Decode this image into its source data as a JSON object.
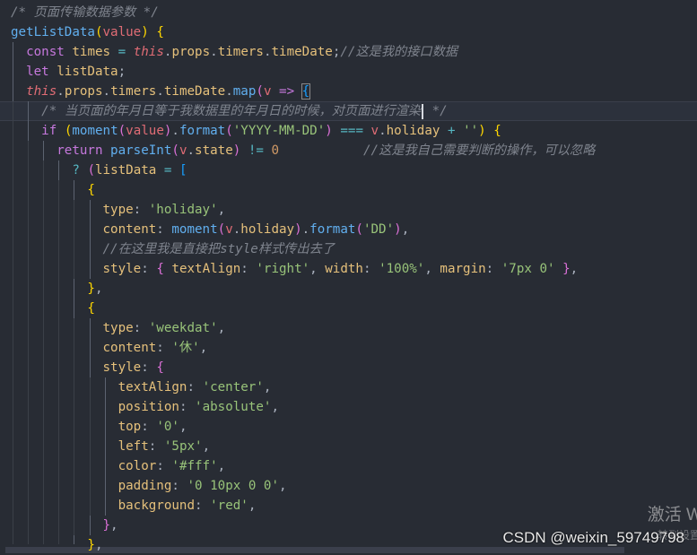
{
  "editor": {
    "lines": [
      [
        [
          "c-com",
          "/* 页面传输数据参数 */"
        ]
      ],
      [
        [
          "c-fn",
          "getListData"
        ],
        [
          "c-br1",
          "("
        ],
        [
          "c-id",
          "value"
        ],
        [
          "c-br1",
          ")"
        ],
        [
          "c-pun",
          " "
        ],
        [
          "c-br1",
          "{"
        ]
      ],
      [
        [
          "c-kw",
          "const"
        ],
        [
          "c-pun",
          " "
        ],
        [
          "c-var",
          "times"
        ],
        [
          "c-pun",
          " "
        ],
        [
          "c-op",
          "="
        ],
        [
          "c-pun",
          " "
        ],
        [
          "c-this",
          "this"
        ],
        [
          "c-pun",
          "."
        ],
        [
          "c-prop",
          "props"
        ],
        [
          "c-pun",
          "."
        ],
        [
          "c-prop",
          "timers"
        ],
        [
          "c-pun",
          "."
        ],
        [
          "c-prop",
          "timeDate"
        ],
        [
          "c-pun",
          ";"
        ],
        [
          "c-com",
          "//这是我的接口数据"
        ]
      ],
      [
        [
          "c-kw",
          "let"
        ],
        [
          "c-pun",
          " "
        ],
        [
          "c-var",
          "listData"
        ],
        [
          "c-pun",
          ";"
        ]
      ],
      [
        [
          "c-this",
          "this"
        ],
        [
          "c-pun",
          "."
        ],
        [
          "c-prop",
          "props"
        ],
        [
          "c-pun",
          "."
        ],
        [
          "c-prop",
          "timers"
        ],
        [
          "c-pun",
          "."
        ],
        [
          "c-prop",
          "timeDate"
        ],
        [
          "c-pun",
          "."
        ],
        [
          "c-fn",
          "map"
        ],
        [
          "c-br2",
          "("
        ],
        [
          "c-id",
          "v"
        ],
        [
          "c-pun",
          " "
        ],
        [
          "c-kw",
          "=>"
        ],
        [
          "c-pun",
          " "
        ],
        [
          "c-br3",
          "{"
        ]
      ],
      [
        [
          "c-com",
          "/* 当页面的年月日等于我数据里的年月日的时候，对页面进行渲染"
        ],
        [
          "cursor",
          ""
        ],
        [
          "c-com",
          " */"
        ]
      ],
      [
        [
          "c-kw",
          "if"
        ],
        [
          "c-pun",
          " "
        ],
        [
          "c-br1",
          "("
        ],
        [
          "c-fn",
          "moment"
        ],
        [
          "c-br2",
          "("
        ],
        [
          "c-id",
          "value"
        ],
        [
          "c-br2",
          ")"
        ],
        [
          "c-pun",
          "."
        ],
        [
          "c-fn",
          "format"
        ],
        [
          "c-br2",
          "("
        ],
        [
          "c-str",
          "'YYYY-MM-DD'"
        ],
        [
          "c-br2",
          ")"
        ],
        [
          "c-pun",
          " "
        ],
        [
          "c-op",
          "==="
        ],
        [
          "c-pun",
          " "
        ],
        [
          "c-id",
          "v"
        ],
        [
          "c-pun",
          "."
        ],
        [
          "c-prop",
          "holiday"
        ],
        [
          "c-pun",
          " "
        ],
        [
          "c-op",
          "+"
        ],
        [
          "c-pun",
          " "
        ],
        [
          "c-str",
          "''"
        ],
        [
          "c-br1",
          ")"
        ],
        [
          "c-pun",
          " "
        ],
        [
          "c-br1",
          "{"
        ]
      ],
      [
        [
          "c-kw",
          "return"
        ],
        [
          "c-pun",
          " "
        ],
        [
          "c-fn",
          "parseInt"
        ],
        [
          "c-br2",
          "("
        ],
        [
          "c-id",
          "v"
        ],
        [
          "c-pun",
          "."
        ],
        [
          "c-prop",
          "state"
        ],
        [
          "c-br2",
          ")"
        ],
        [
          "c-pun",
          " "
        ],
        [
          "c-op",
          "!="
        ],
        [
          "c-pun",
          " "
        ],
        [
          "c-num",
          "0"
        ],
        [
          "c-pun",
          "           "
        ],
        [
          "c-com",
          "//这是我自己需要判断的操作，可以忽略"
        ]
      ],
      [
        [
          "c-op",
          "?"
        ],
        [
          "c-pun",
          " "
        ],
        [
          "c-br2",
          "("
        ],
        [
          "c-var",
          "listData"
        ],
        [
          "c-pun",
          " "
        ],
        [
          "c-op",
          "="
        ],
        [
          "c-pun",
          " "
        ],
        [
          "c-br3",
          "["
        ]
      ],
      [
        [
          "c-br1",
          "{"
        ]
      ],
      [
        [
          "c-key",
          "type"
        ],
        [
          "c-pun",
          ": "
        ],
        [
          "c-str",
          "'holiday'"
        ],
        [
          "c-pun",
          ","
        ]
      ],
      [
        [
          "c-key",
          "content"
        ],
        [
          "c-pun",
          ": "
        ],
        [
          "c-fn",
          "moment"
        ],
        [
          "c-br2",
          "("
        ],
        [
          "c-id",
          "v"
        ],
        [
          "c-pun",
          "."
        ],
        [
          "c-prop",
          "holiday"
        ],
        [
          "c-br2",
          ")"
        ],
        [
          "c-pun",
          "."
        ],
        [
          "c-fn",
          "format"
        ],
        [
          "c-br2",
          "("
        ],
        [
          "c-str",
          "'DD'"
        ],
        [
          "c-br2",
          ")"
        ],
        [
          "c-pun",
          ","
        ]
      ],
      [
        [
          "c-com",
          "//在这里我是直接把style样式传出去了"
        ]
      ],
      [
        [
          "c-key",
          "style"
        ],
        [
          "c-pun",
          ": "
        ],
        [
          "c-br2",
          "{"
        ],
        [
          "c-pun",
          " "
        ],
        [
          "c-key",
          "textAlign"
        ],
        [
          "c-pun",
          ": "
        ],
        [
          "c-str",
          "'right'"
        ],
        [
          "c-pun",
          ", "
        ],
        [
          "c-key",
          "width"
        ],
        [
          "c-pun",
          ": "
        ],
        [
          "c-str",
          "'100%'"
        ],
        [
          "c-pun",
          ", "
        ],
        [
          "c-key",
          "margin"
        ],
        [
          "c-pun",
          ": "
        ],
        [
          "c-str",
          "'7px 0'"
        ],
        [
          "c-pun",
          " "
        ],
        [
          "c-br2",
          "}"
        ],
        [
          "c-pun",
          ","
        ]
      ],
      [
        [
          "c-br1",
          "}"
        ],
        [
          "c-pun",
          ","
        ]
      ],
      [
        [
          "c-br1",
          "{"
        ]
      ],
      [
        [
          "c-key",
          "type"
        ],
        [
          "c-pun",
          ": "
        ],
        [
          "c-str",
          "'weekdat'"
        ],
        [
          "c-pun",
          ","
        ]
      ],
      [
        [
          "c-key",
          "content"
        ],
        [
          "c-pun",
          ": "
        ],
        [
          "c-str",
          "'休'"
        ],
        [
          "c-pun",
          ","
        ]
      ],
      [
        [
          "c-key",
          "style"
        ],
        [
          "c-pun",
          ": "
        ],
        [
          "c-br2",
          "{"
        ]
      ],
      [
        [
          "c-key",
          "textAlign"
        ],
        [
          "c-pun",
          ": "
        ],
        [
          "c-str",
          "'center'"
        ],
        [
          "c-pun",
          ","
        ]
      ],
      [
        [
          "c-key",
          "position"
        ],
        [
          "c-pun",
          ": "
        ],
        [
          "c-str",
          "'absolute'"
        ],
        [
          "c-pun",
          ","
        ]
      ],
      [
        [
          "c-key",
          "top"
        ],
        [
          "c-pun",
          ": "
        ],
        [
          "c-str",
          "'0'"
        ],
        [
          "c-pun",
          ","
        ]
      ],
      [
        [
          "c-key",
          "left"
        ],
        [
          "c-pun",
          ": "
        ],
        [
          "c-str",
          "'5px'"
        ],
        [
          "c-pun",
          ","
        ]
      ],
      [
        [
          "c-key",
          "color"
        ],
        [
          "c-pun",
          ": "
        ],
        [
          "c-str",
          "'#fff'"
        ],
        [
          "c-pun",
          ","
        ]
      ],
      [
        [
          "c-key",
          "padding"
        ],
        [
          "c-pun",
          ": "
        ],
        [
          "c-str",
          "'0 10px 0 0'"
        ],
        [
          "c-pun",
          ","
        ]
      ],
      [
        [
          "c-key",
          "background"
        ],
        [
          "c-pun",
          ": "
        ],
        [
          "c-str",
          "'red'"
        ],
        [
          "c-pun",
          ","
        ]
      ],
      [
        [
          "c-br2",
          "}"
        ],
        [
          "c-pun",
          ","
        ]
      ],
      [
        [
          "c-br1",
          "}"
        ],
        [
          "c-pun",
          ","
        ]
      ]
    ]
  },
  "watermarks": {
    "csdn": "CSDN @weixin_59749798",
    "windows_activate": "激活 W",
    "windows_sub": "转到设置"
  },
  "colors": {
    "background": "#282c34",
    "comment": "#7f848e",
    "function": "#61afef",
    "keyword": "#c678dd",
    "string": "#98c379",
    "property": "#e5c07b",
    "number": "#d19a66"
  }
}
